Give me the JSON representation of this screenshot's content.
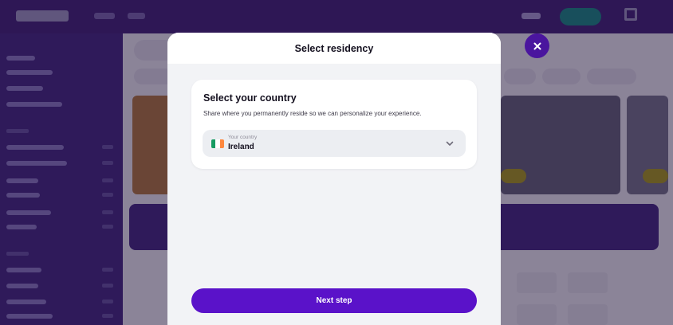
{
  "background": {
    "brand_color": "#3a1a6e",
    "accent_color": "#137a7a"
  },
  "modal": {
    "title": "Select residency",
    "close_icon": "close-icon",
    "card": {
      "heading": "Select your country",
      "description": "Share where you permanently reside so we can personalize your experience."
    },
    "country_select": {
      "label": "Your country",
      "value": "Ireland",
      "flag_icon": "ireland-flag-icon",
      "flag_colors": [
        "#169b62",
        "#ffffff",
        "#ff883e"
      ],
      "chevron_icon": "chevron-down-icon"
    },
    "next_button": "Next step",
    "primary_color": "#5a12c9"
  }
}
